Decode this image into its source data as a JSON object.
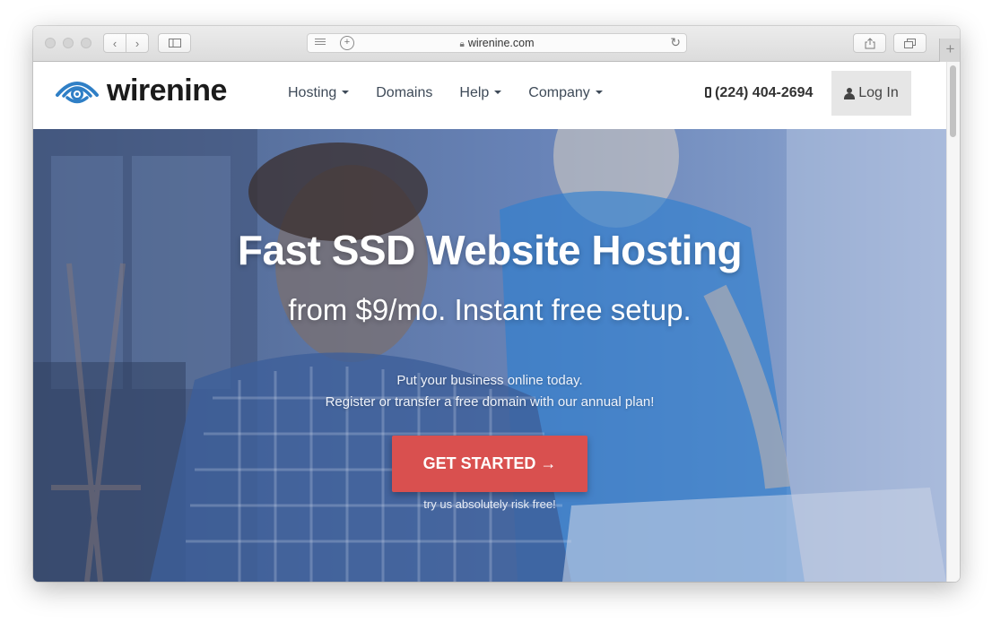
{
  "browser": {
    "url": "wirenine.com",
    "lock_icon": "lock-icon",
    "back_icon": "chevron-left-icon",
    "forward_icon": "chevron-right-icon",
    "sidebar_icon": "sidebar-icon",
    "reader_icon": "reader-icon",
    "add_icon": "plus-icon",
    "reload_icon": "reload-icon",
    "share_icon": "share-icon",
    "tabs_icon": "tabs-icon",
    "new_tab_label": "+"
  },
  "site": {
    "brand": "wirenine",
    "nav": [
      {
        "label": "Hosting",
        "dropdown": true
      },
      {
        "label": "Domains",
        "dropdown": false
      },
      {
        "label": "Help",
        "dropdown": true
      },
      {
        "label": "Company",
        "dropdown": true
      }
    ],
    "phone": "(224) 404-2694",
    "login_label": "Log In"
  },
  "hero": {
    "title": "Fast SSD Website Hosting",
    "subtitle": "from $9/mo. Instant free setup.",
    "line1": "Put your business online today.",
    "line2": "Register or transfer a free domain with our annual plan!",
    "cta_label": "GET STARTED →",
    "note": "try us absolutely risk free!"
  },
  "colors": {
    "cta": "#d9504f",
    "brand_blue": "#2f7fc6",
    "hero_tint": "#5e78a8",
    "login_bg": "#e6e6e6"
  }
}
